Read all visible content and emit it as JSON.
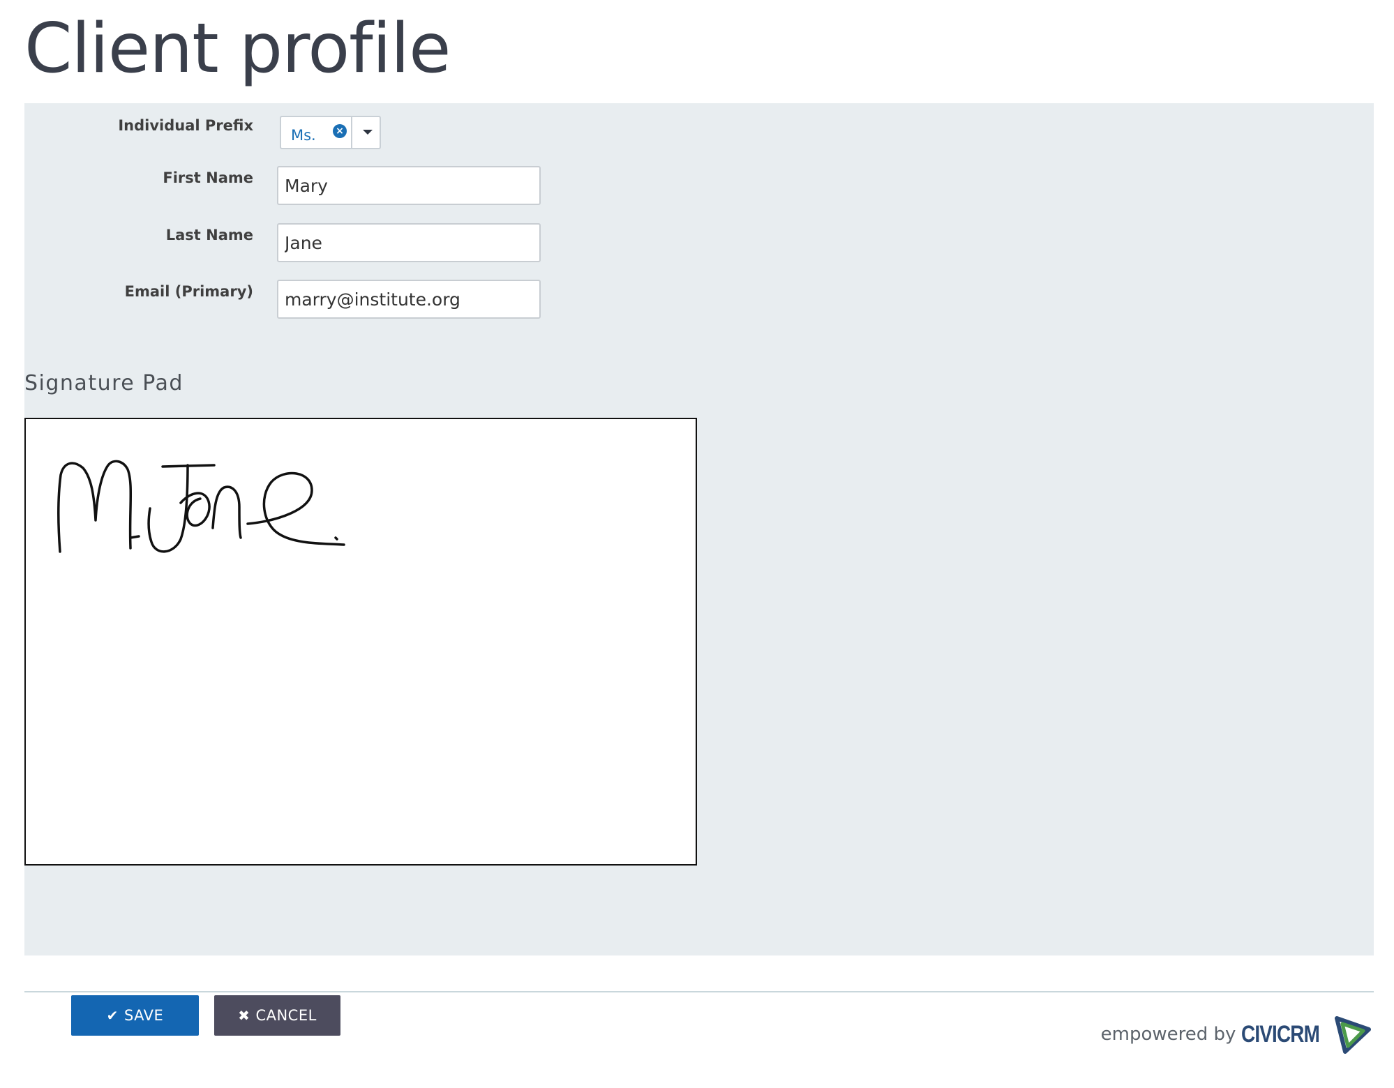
{
  "page": {
    "title": "Client profile"
  },
  "form": {
    "prefix": {
      "label": "Individual Prefix",
      "value": "Ms.",
      "clear_icon": "times-circle-icon",
      "caret_icon": "caret-down-icon"
    },
    "first_name": {
      "label": "First Name",
      "value": "Mary"
    },
    "last_name": {
      "label": "Last Name",
      "value": "Jane"
    },
    "email": {
      "label": "Email (Primary)",
      "value": "marry@institute.org"
    }
  },
  "signature": {
    "title": "Signature Pad",
    "drawn_text": "M.Jane"
  },
  "actions": {
    "save_label": "SAVE",
    "save_icon": "check-icon",
    "cancel_label": "CANCEL",
    "cancel_icon": "times-icon"
  },
  "footer": {
    "prefix": "empowered by",
    "brand": "CIVICRM",
    "logo_icon": "civicrm-logo-icon"
  },
  "colors": {
    "panel_bg": "#e8edf0",
    "save_btn": "#1466b2",
    "cancel_btn": "#4d4c5e",
    "link_blue": "#1a6fb5",
    "brand_blue": "#2b4a75",
    "brand_green": "#4c9a4a"
  }
}
